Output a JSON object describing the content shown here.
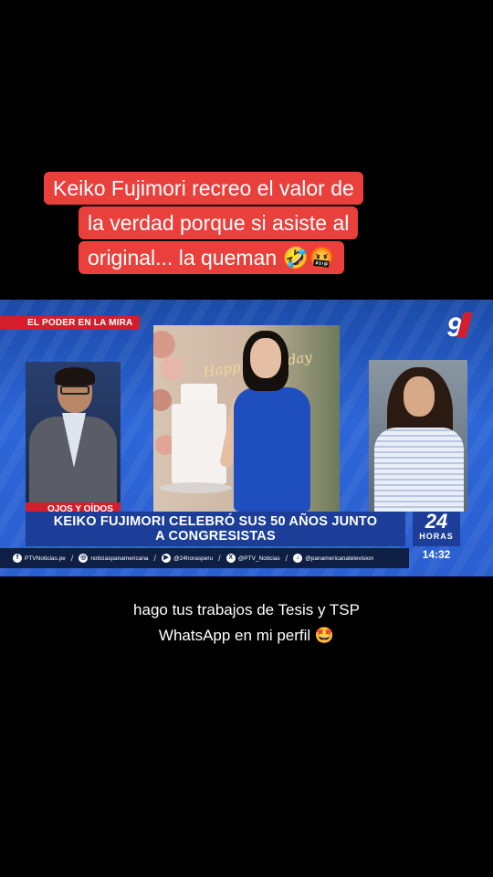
{
  "top_caption": {
    "lines": [
      "Keiko Fujimori recreo el valor de",
      "la verdad porque si asiste al",
      "original... la queman 🤣🤬"
    ]
  },
  "broadcast": {
    "segment_tag": "EL PODER EN LA MIRA",
    "channel_logo": "9",
    "section_tag": "OJOS Y OÍDOS",
    "headline": {
      "line1": "KEIKO FUJIMORI CELEBRÓ SUS 50 AÑOS JUNTO",
      "line2": "A CONGRESISTAS"
    },
    "program_logo": {
      "number": "24",
      "label": "HORAS"
    },
    "clock": "14:32",
    "cake_text": "Happy Birthday",
    "social": [
      {
        "icon": "facebook-icon",
        "glyph": "f",
        "handle": "PTVNoticias.pe"
      },
      {
        "icon": "instagram-icon",
        "glyph": "◎",
        "handle": "noticiaspanamericana"
      },
      {
        "icon": "youtube-icon",
        "glyph": "▶",
        "handle": "@24horasperu"
      },
      {
        "icon": "x-icon",
        "glyph": "X",
        "handle": "@PTV_Noticias"
      },
      {
        "icon": "tiktok-icon",
        "glyph": "♪",
        "handle": "@panamericanatelevision"
      }
    ]
  },
  "bottom_caption": {
    "line1": "hago tus trabajos de Tesis y TSP",
    "line2": "WhatsApp en mi perfil 🤩"
  },
  "colors": {
    "caption_bg": "#e9403c",
    "brand_red": "#d21f2b",
    "brand_blue": "#1c3e98",
    "background": "#000000"
  }
}
